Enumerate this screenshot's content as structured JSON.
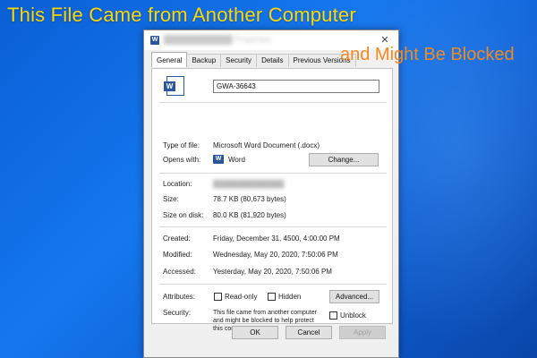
{
  "headline": {
    "line1": "This File Came from Another Computer",
    "line2": "and Might Be Blocked"
  },
  "colors": {
    "background": "#1577ee",
    "headline1": "#ffd800",
    "headline2": "#f28a22",
    "word_blue": "#2b579a"
  },
  "dialog": {
    "title_icon": "W",
    "close_label": "✕",
    "tabs": [
      "General",
      "Backup",
      "Security",
      "Details",
      "Previous Versions"
    ],
    "file_icon": "W",
    "file_name": "GWA-36643",
    "type_label": "Type of file:",
    "type_value": "Microsoft Word Document (.docx)",
    "opens_label": "Opens with:",
    "opens_icon": "W",
    "opens_value": "Word",
    "change_label": "Change...",
    "location_label": "Location:",
    "size_label": "Size:",
    "size_value": "78.7 KB (80,673 bytes)",
    "disk_label": "Size on disk:",
    "disk_value": "80.0 KB (81,920 bytes)",
    "created_label": "Created:",
    "created_value": "Friday, December 31, 4500, 4:00:00 PM",
    "modified_label": "Modified:",
    "modified_value": "Wednesday, May 20, 2020, 7:50:06 PM",
    "accessed_label": "Accessed:",
    "accessed_value": "Yesterday, May 20, 2020, 7:50:06 PM",
    "attributes_label": "Attributes:",
    "readonly_label": "Read-only",
    "hidden_label": "Hidden",
    "advanced_label": "Advanced...",
    "security_label": "Security:",
    "security_text": "This file came from another computer and might be blocked to help protect this computer.",
    "unblock_label": "Unblock",
    "ok_label": "OK",
    "cancel_label": "Cancel",
    "apply_label": "Apply"
  }
}
